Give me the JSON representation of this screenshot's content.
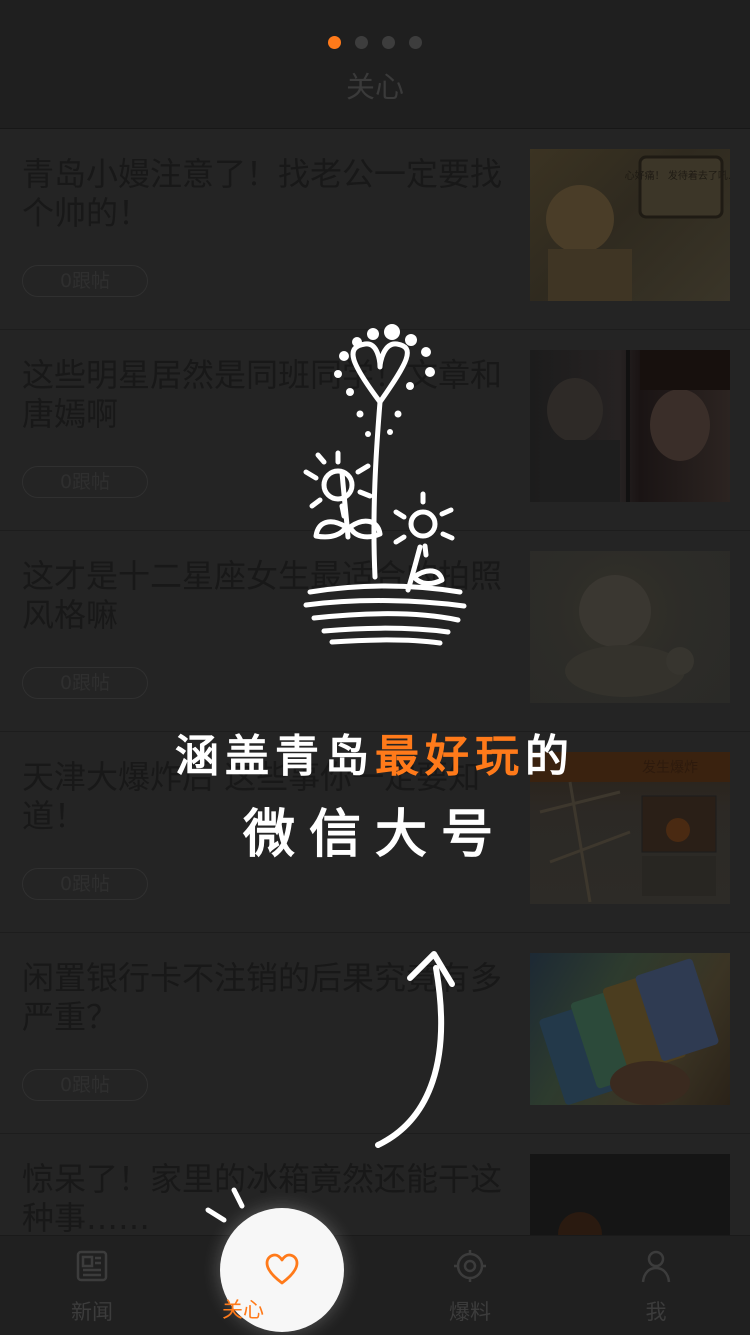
{
  "header": {
    "page_title": "关心",
    "page_indicator": {
      "count": 4,
      "active_index": 0
    }
  },
  "feed": {
    "items": [
      {
        "title": "青岛小嫚注意了！找老公一定要找个帅的！",
        "badge": "0跟帖",
        "thumb_caption": "心好痛！ 发待着去了吼..."
      },
      {
        "title": "这些明星居然是同班同学！文章和唐嫣啊",
        "badge": "0跟帖"
      },
      {
        "title": "这才是十二星座女生最适合的拍照风格嘛",
        "badge": "0跟帖"
      },
      {
        "title": "天津大爆炸后 这些事你一定要知道！",
        "badge": "0跟帖",
        "thumb_caption": "发生爆炸"
      },
      {
        "title": "闲置银行卡不注销的后果究竟有多严重？",
        "badge": "0跟帖"
      },
      {
        "title": "惊呆了！家里的冰箱竟然还能干这种事……",
        "badge": ""
      }
    ]
  },
  "overlay": {
    "line1_prefix": "涵盖青岛",
    "line1_highlight": "最好玩",
    "line1_suffix": "的",
    "line2": "微信大号",
    "highlight_color": "#ff7a1a"
  },
  "tabbar": {
    "tabs": [
      {
        "label": "新闻",
        "icon": "newspaper-icon"
      },
      {
        "label": "关心",
        "icon": "heart-icon",
        "active": true
      },
      {
        "label": "爆料",
        "icon": "target-icon"
      },
      {
        "label": "我",
        "icon": "person-icon"
      }
    ],
    "active_color": "#ff7a1a"
  }
}
